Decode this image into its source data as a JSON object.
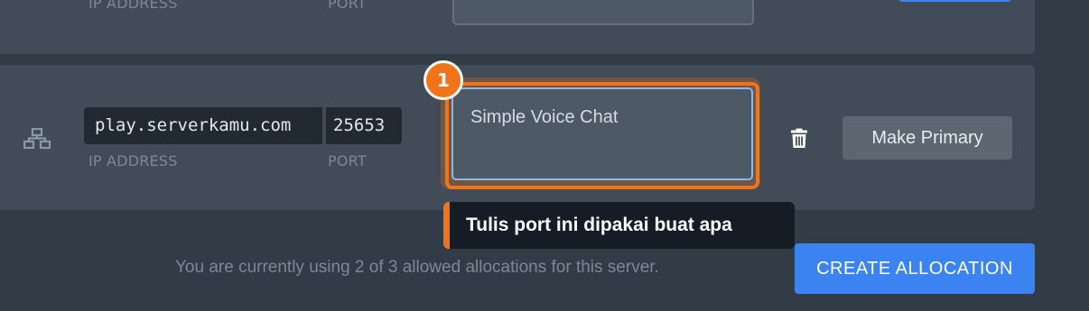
{
  "previous_allocation": {
    "ip_label": "IP ADDRESS",
    "port_label": "PORT"
  },
  "allocation": {
    "ip": "play.serverkamu.com",
    "port": "25653",
    "ip_label": "IP ADDRESS",
    "port_label": "PORT",
    "notes_value": "Simple Voice Chat",
    "make_primary_label": "Make Primary",
    "network_icon": "network-icon",
    "delete_icon": "trash-icon"
  },
  "guide": {
    "step_number": "1",
    "tooltip_text": "Tulis port ini dipakai buat apa",
    "accent_color": "#f27418"
  },
  "footer": {
    "usage_text": "You are currently using 2 of 3 allowed allocations for this server.",
    "create_button_label": "CREATE ALLOCATION",
    "create_button_color": "#3c83f2"
  }
}
